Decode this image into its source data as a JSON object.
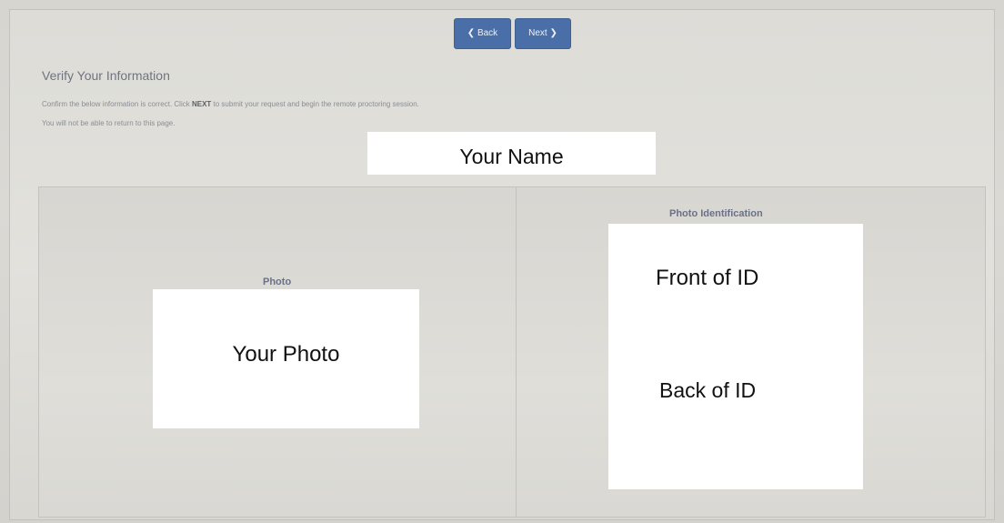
{
  "nav": {
    "back_label": "❮ Back",
    "next_label": "Next ❯"
  },
  "page": {
    "title": "Verify Your Information",
    "instruction_before_bold": "Confirm the below information is correct. Click ",
    "instruction_bold": "NEXT",
    "instruction_after_bold": " to submit your request and begin the remote proctoring session.",
    "instruction_2": "You will not be able to return to this page."
  },
  "name_field": {
    "value": "Your Name"
  },
  "photo_panel": {
    "heading": "Photo",
    "placeholder": "Your Photo"
  },
  "id_panel": {
    "heading": "Photo Identification",
    "front_label": "Front of ID",
    "back_label": "Back of ID"
  },
  "colors": {
    "button_blue": "#4a6fa8",
    "heading_blue": "#6a7089",
    "background_gray": "#d9d8d3"
  }
}
